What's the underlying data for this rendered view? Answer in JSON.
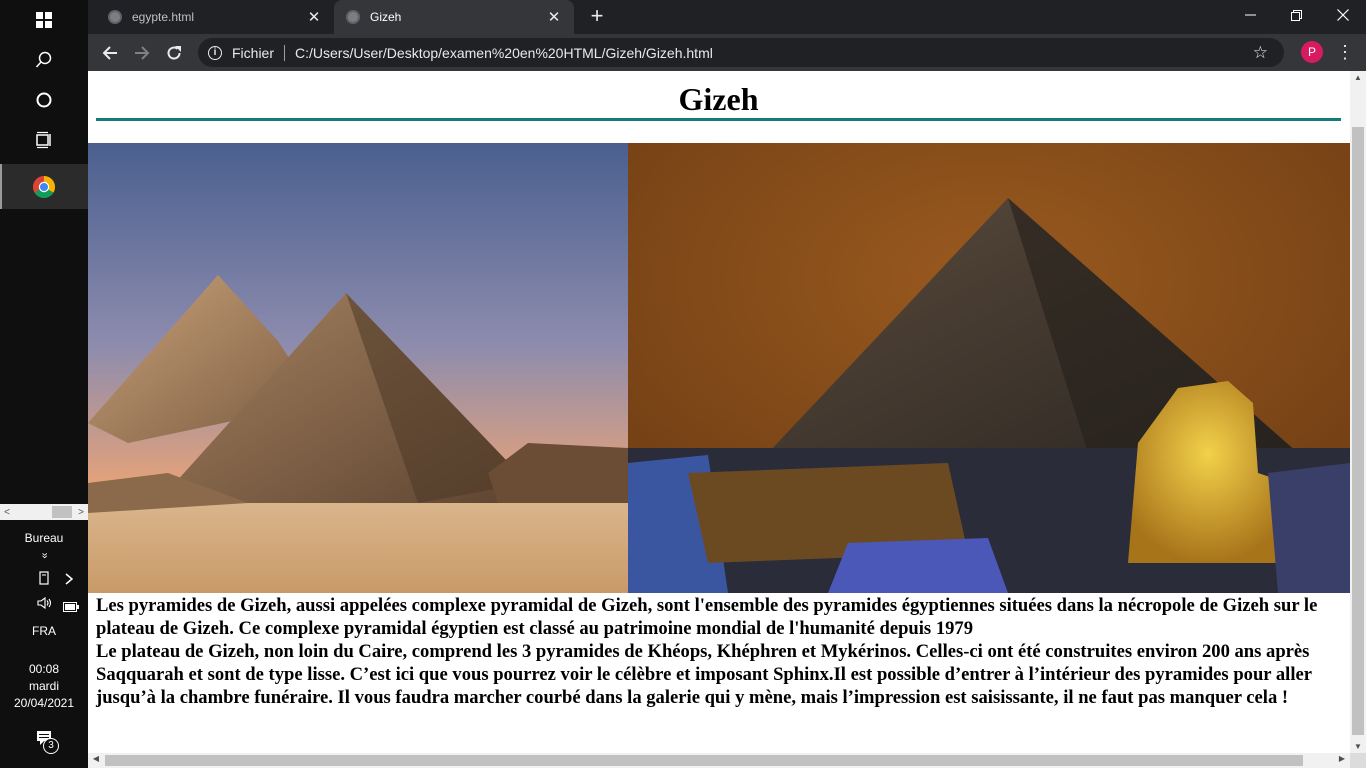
{
  "taskbar": {
    "start_icon": "windows-logo-icon",
    "search_icon": "search-icon",
    "cortana_icon": "cortana-circle-icon",
    "taskview_icon": "task-view-icon",
    "chrome_icon": "chrome-icon",
    "scroll_left": "<",
    "scroll_right": ">",
    "desktop_label": "Bureau",
    "desktop_chevron": "»",
    "language": "FRA",
    "time": "00:08",
    "day": "mardi",
    "date": "20/04/2021",
    "notification_count": "3"
  },
  "browser": {
    "tabs": [
      {
        "title": "egypte.html",
        "active": false,
        "close": "✕"
      },
      {
        "title": "Gizeh",
        "active": true,
        "close": "✕"
      }
    ],
    "new_tab": "+",
    "window_controls": {
      "minimize": "—",
      "restore": "❐",
      "close": "✕"
    },
    "nav": {
      "back": "←",
      "forward": "→",
      "reload": "↻"
    },
    "address": {
      "info_glyph": "i",
      "scheme_label": "Fichier",
      "url": "C:/Users/User/Desktop/examen%20en%20HTML/Gizeh/Gizeh.html"
    },
    "bookmark_star": "☆",
    "profile_initial": "P",
    "menu": "⋮"
  },
  "page": {
    "heading": "Gizeh",
    "images": [
      {
        "alt": "pyramids-day-photo"
      },
      {
        "alt": "pyramid-sphinx-night-photo"
      }
    ],
    "paragraph1": "Les pyramides de Gizeh, aussi appelées complexe pyramidal de Gizeh, sont l'ensemble des pyramides égyptiennes situées dans la nécropole de Gizeh sur le plateau de Gizeh. Ce complexe pyramidal égyptien est classé au patrimoine mondial de l'humanité depuis 1979",
    "paragraph2": "Le plateau de Gizeh, non loin du Caire, comprend les 3 pyramides de Khéops, Khéphren et Mykérinos. Celles-ci ont été construites environ 200 ans après Saqquarah et sont de type lisse. C’est ici que vous pourrez voir le célèbre et imposant Sphinx.Il est possible d’entrer à l’intérieur des pyramides pour aller jusqu’à la chambre funéraire. Il vous faudra marcher courbé dans la galerie qui y mène, mais l’impression est saisissante, il ne faut pas manquer cela !"
  },
  "colors": {
    "title_rule": "#137b7b",
    "profile": "#d81b60"
  }
}
